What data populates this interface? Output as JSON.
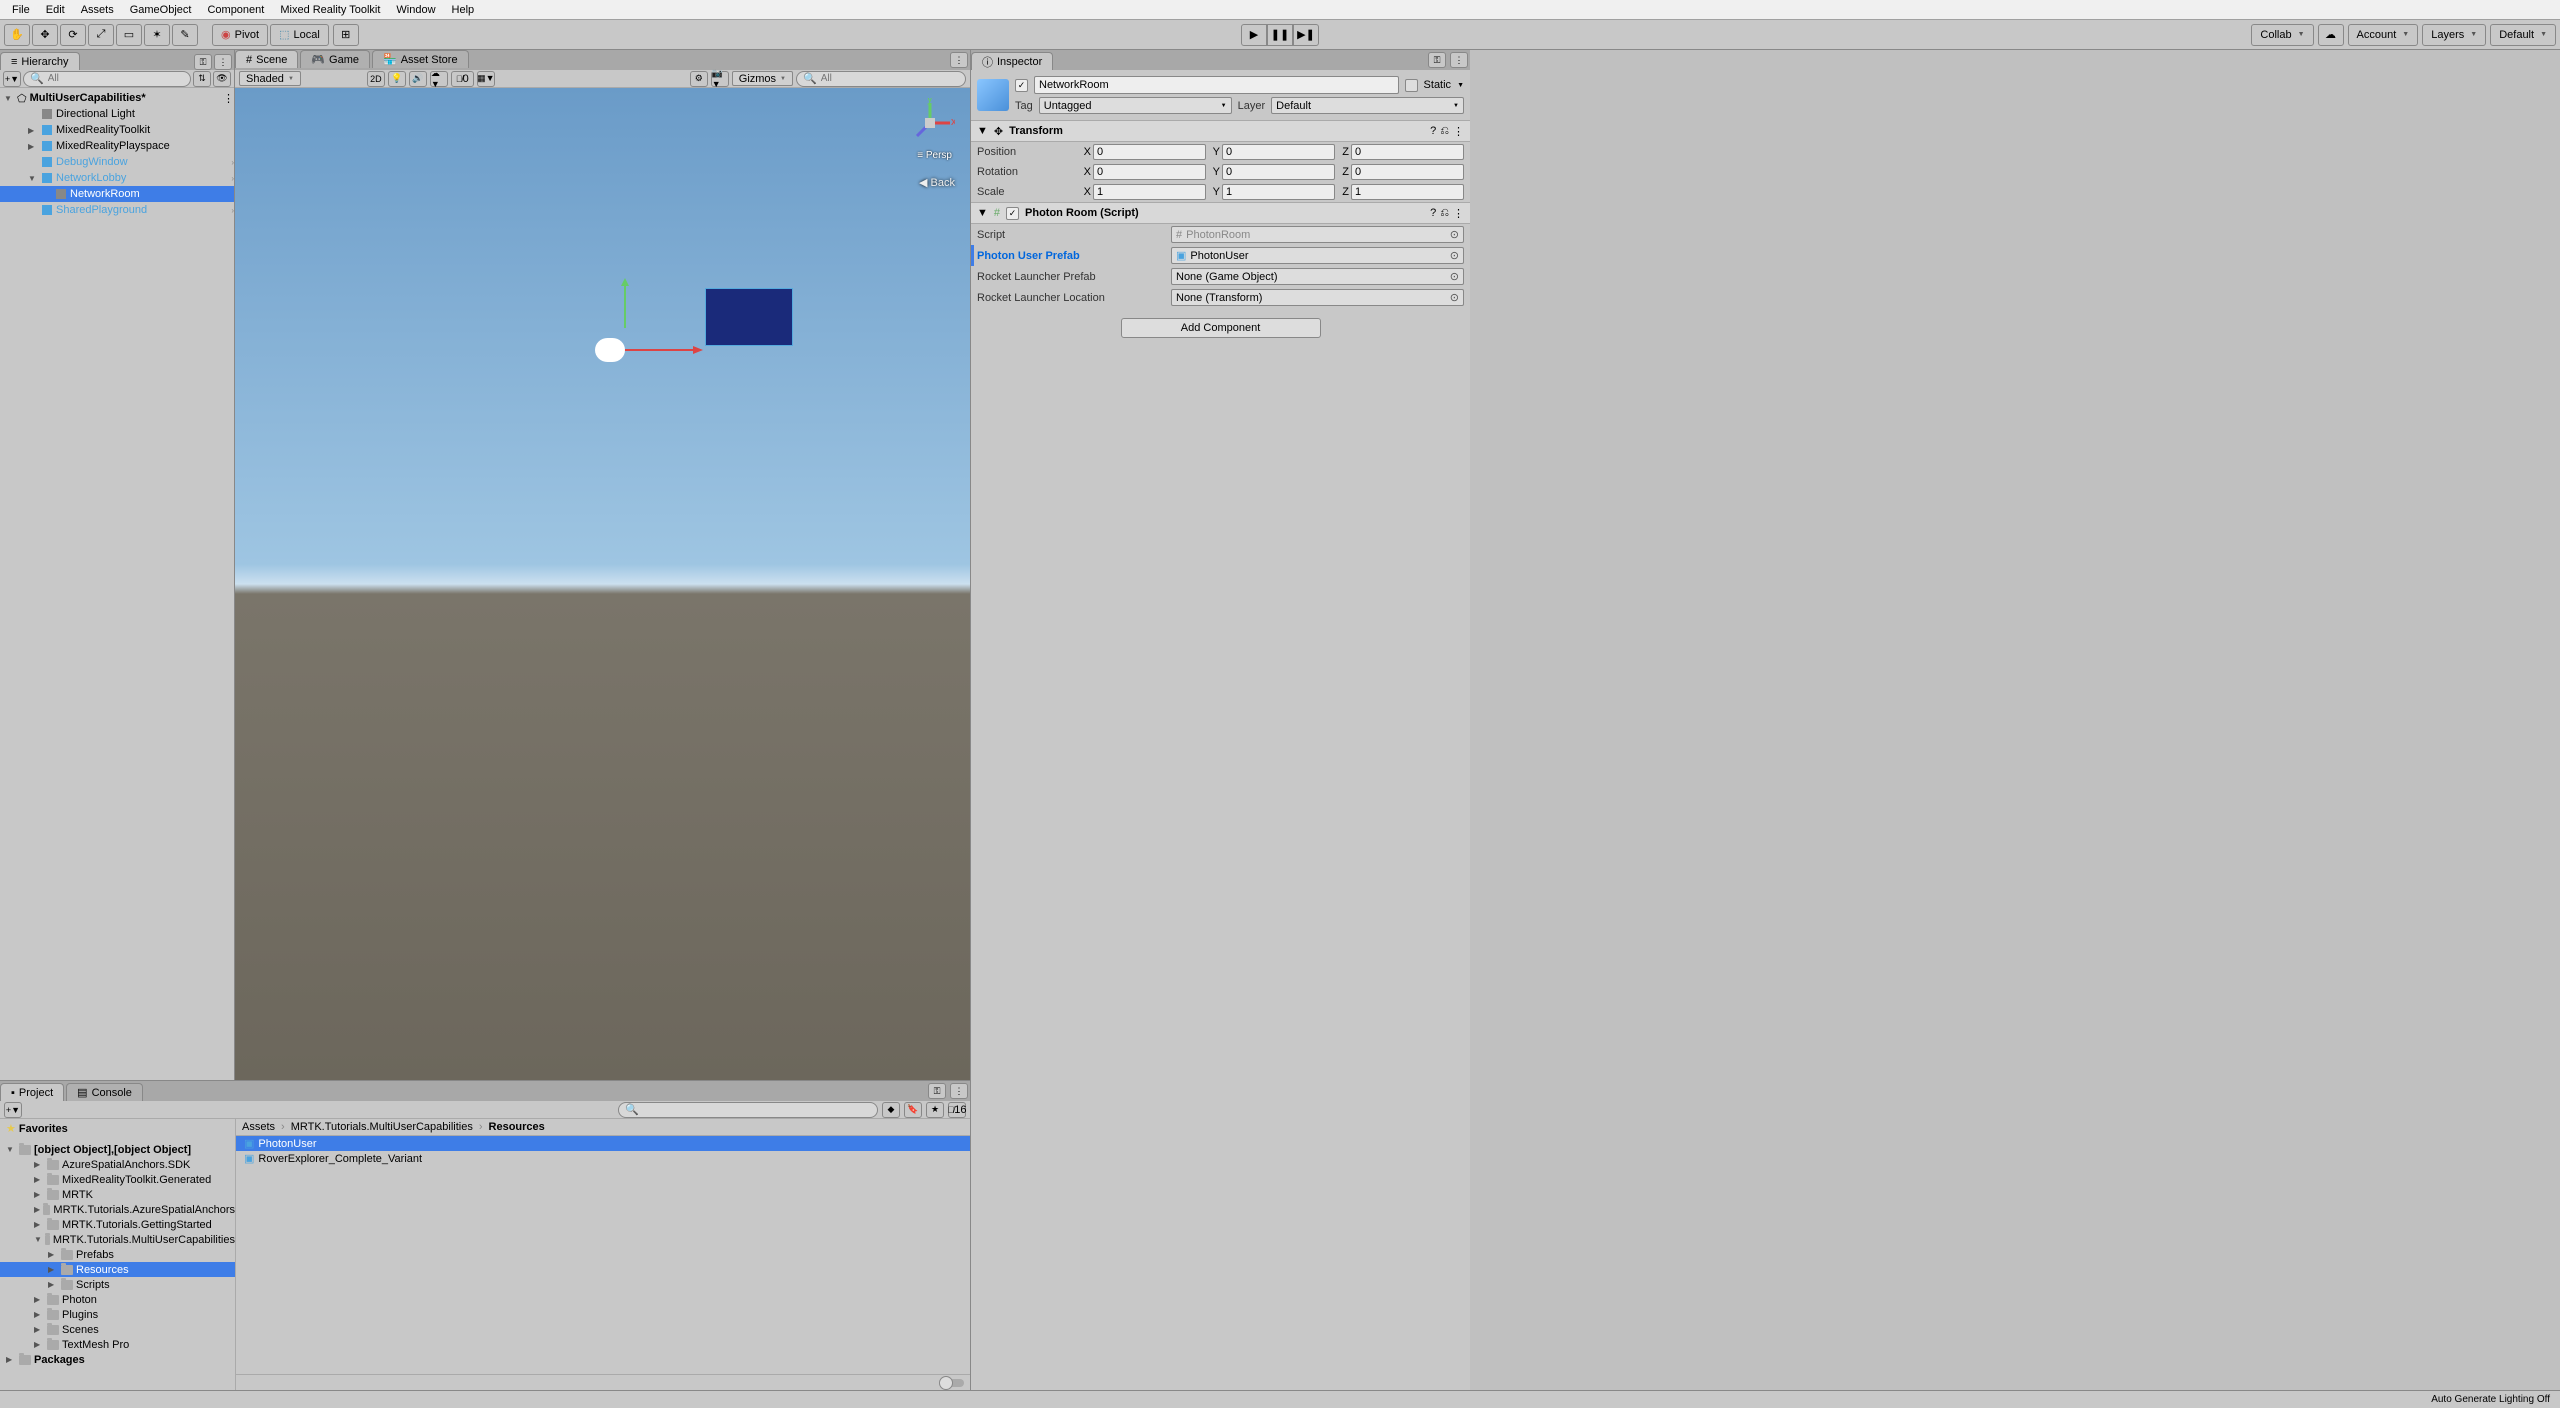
{
  "menu": [
    "File",
    "Edit",
    "Assets",
    "GameObject",
    "Component",
    "Mixed Reality Toolkit",
    "Window",
    "Help"
  ],
  "toolbar": {
    "pivot": "Pivot",
    "local": "Local",
    "collab": "Collab",
    "account": "Account",
    "layers": "Layers",
    "layout": "Default"
  },
  "hierarchy": {
    "title": "Hierarchy",
    "search_placeholder": "All",
    "scene_name": "MultiUserCapabilities*",
    "items": [
      {
        "label": "Directional Light",
        "indent": 1,
        "blue": false
      },
      {
        "label": "MixedRealityToolkit",
        "indent": 1,
        "blue": true,
        "expander": "▶"
      },
      {
        "label": "MixedRealityPlayspace",
        "indent": 1,
        "blue": true,
        "expander": "▶"
      },
      {
        "label": "DebugWindow",
        "indent": 1,
        "blue": true,
        "color": "#4aa3df",
        "arrow_right": true
      },
      {
        "label": "NetworkLobby",
        "indent": 1,
        "blue": true,
        "color": "#4aa3df",
        "expander": "▼",
        "arrow_right": true
      },
      {
        "label": "NetworkRoom",
        "indent": 2,
        "selected": true
      },
      {
        "label": "SharedPlayground",
        "indent": 1,
        "blue": true,
        "color": "#4aa3df",
        "arrow_right": true
      }
    ]
  },
  "scene_tabs": {
    "scene": "Scene",
    "game": "Game",
    "asset_store": "Asset Store"
  },
  "scene_toolbar": {
    "shading": "Shaded",
    "twod": "2D",
    "hidden_count": "0",
    "gizmos": "Gizmos",
    "search_placeholder": "All",
    "back": "◀ Back",
    "persp": "≡ Persp"
  },
  "project": {
    "title": "Project",
    "console": "Console",
    "favorites": "Favorites",
    "assets": [
      {
        "label": "PhotonUser",
        "selected": true
      },
      {
        "label": "RoverExplorer_Complete_Variant"
      }
    ],
    "packages": "Packages",
    "slider_badge": "16",
    "tree": [
      {
        "label": "AzureSpatialAnchors.SDK",
        "indent": 2
      },
      {
        "label": "MixedRealityToolkit.Generated",
        "indent": 2
      },
      {
        "label": "MRTK",
        "indent": 2
      },
      {
        "label": "MRTK.Tutorials.AzureSpatialAnchors",
        "indent": 2
      },
      {
        "label": "MRTK.Tutorials.GettingStarted",
        "indent": 2
      },
      {
        "label": "MRTK.Tutorials.MultiUserCapabilities",
        "indent": 2,
        "expanded": true
      },
      {
        "label": "Prefabs",
        "indent": 3
      },
      {
        "label": "Resources",
        "indent": 3,
        "selected": true
      },
      {
        "label": "Scripts",
        "indent": 3
      },
      {
        "label": "Photon",
        "indent": 2
      },
      {
        "label": "Plugins",
        "indent": 2
      },
      {
        "label": "Scenes",
        "indent": 2
      },
      {
        "label": "TextMesh Pro",
        "indent": 2
      }
    ],
    "breadcrumb": [
      "Assets",
      "MRTK.Tutorials.MultiUserCapabilities",
      "Resources"
    ]
  },
  "inspector": {
    "title": "Inspector",
    "object_name": "NetworkRoom",
    "static": "Static",
    "tag_label": "Tag",
    "tag_value": "Untagged",
    "layer_label": "Layer",
    "layer_value": "Default",
    "transform": {
      "title": "Transform",
      "position": {
        "label": "Position",
        "x": "0",
        "y": "0",
        "z": "0"
      },
      "rotation": {
        "label": "Rotation",
        "x": "0",
        "y": "0",
        "z": "0"
      },
      "scale": {
        "label": "Scale",
        "x": "1",
        "y": "1",
        "z": "1"
      }
    },
    "photon_room": {
      "title": "Photon Room (Script)",
      "script_label": "Script",
      "script_value": "PhotonRoom",
      "prefab_label": "Photon User Prefab",
      "prefab_value": "PhotonUser",
      "rocket_prefab_label": "Rocket Launcher Prefab",
      "rocket_prefab_value": "None (Game Object)",
      "rocket_loc_label": "Rocket Launcher Location",
      "rocket_loc_value": "None (Transform)"
    },
    "add_component": "Add Component"
  },
  "status_bar": "Auto Generate Lighting Off"
}
